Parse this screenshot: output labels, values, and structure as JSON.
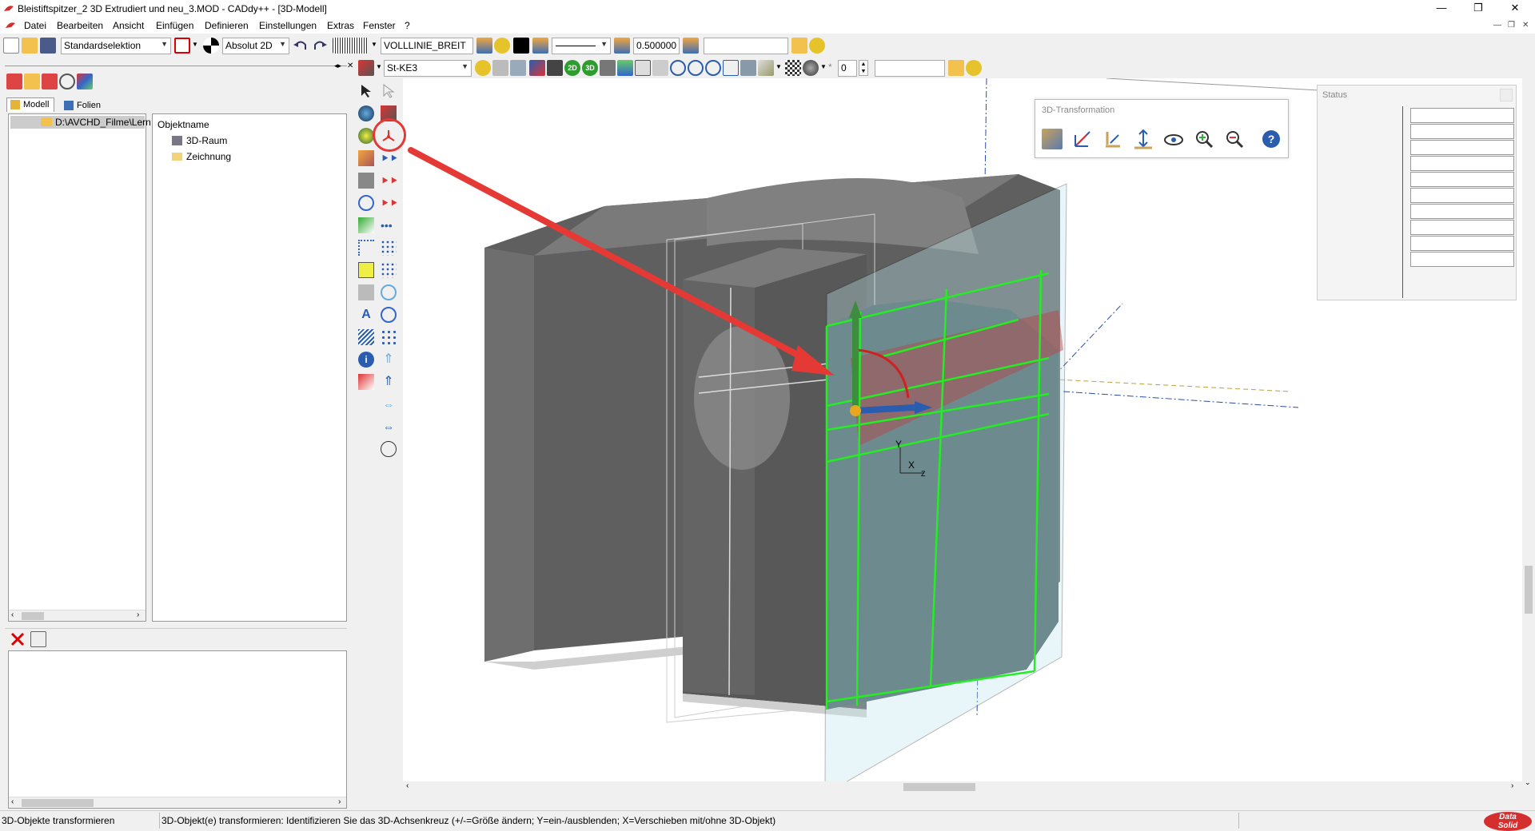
{
  "window": {
    "title": "Bleistiftspitzer_2 3D Extrudiert und neu_3.MOD  -  CADdy++ - [3D-Modell]",
    "minimize": "—",
    "restore": "❐",
    "close": "✕"
  },
  "menu": {
    "items": [
      "Datei",
      "Bearbeiten",
      "Ansicht",
      "Einfügen",
      "Definieren",
      "Einstellungen",
      "Extras",
      "Fenster",
      "?"
    ]
  },
  "toolbar1": {
    "selection_mode": "Standardselektion",
    "coord_mode": "Absolut 2D",
    "linetype": "VOLLLINIE_BREIT",
    "linewidth": "0.500000",
    "empty_field": ""
  },
  "toolbar2": {
    "layer": "St-KE3",
    "label_2d": "2D",
    "label_3d": "3D",
    "count_value": "0",
    "empty_field": ""
  },
  "left_panel": {
    "tabs": [
      "Modell",
      "Folien"
    ],
    "path": "D:\\AVCHD_Filme\\Lern",
    "object_header": "Objektname",
    "objects": [
      "3D-Raum",
      "Zeichnung"
    ]
  },
  "transform_window": {
    "title": "3D-Transformation"
  },
  "status_window": {
    "title": "Status"
  },
  "statusbar": {
    "left": "3D-Objekte transformieren",
    "message": "3D-Objekt(e) transformieren: Identifizieren Sie das 3D-Achsenkreuz (+/-=Größe ändern; Y=ein-/ausblenden; X=Verschieben mit/ohne 3D-Objekt)",
    "logo_line1": "Data",
    "logo_line2": "Solid"
  },
  "viewport": {
    "axis_y": "Y",
    "axis_x": "X",
    "axis_z": "Z"
  },
  "colors": {
    "accent_red": "#e53935",
    "highlight_green": "#22ee22",
    "model_gray": "#6b6b6b"
  }
}
